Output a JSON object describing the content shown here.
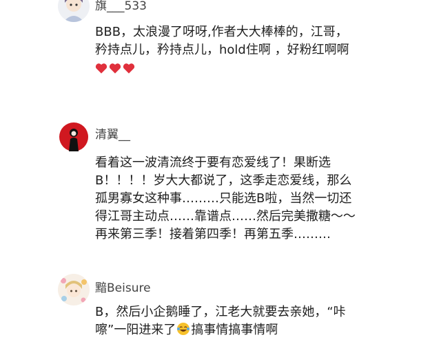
{
  "comments": [
    {
      "username": "旗___533",
      "lines": [
        "BBB，太浪漫了呀呀,作者大大棒棒的，江哥，",
        "矜持点儿，矜持点儿，hold住啊 ，好粉红啊啊"
      ],
      "hearts": 3,
      "avatar_icon": "cartoon-girl-icon"
    },
    {
      "username": "清翼__",
      "lines": [
        "看着这一波清流终于要有恋爱线了！果断选",
        "B！！！！岁大大都说了，这季走恋爱线，那么",
        "孤男寡女这种事………只能选B啦，当然一切还",
        "得江哥主动点……靠谱点……然后完美撒糖～～",
        "再来第三季！接着第四季！再第五季………"
      ],
      "avatar_icon": "red-circle-figure-icon"
    },
    {
      "username": "黯Beisure",
      "lines": [
        "B，然后小企鹅睡了，江老大就要去亲她，“咔",
        "嚓”一阳进来了"
      ],
      "line2_suffix": "搞事情搞事情啊",
      "emoji_icon": "laughing-tears-emoji-icon",
      "avatar_icon": "anime-girl-flowers-icon"
    }
  ],
  "colors": {
    "heart": "#e0303c",
    "accent_red": "#d01820"
  }
}
